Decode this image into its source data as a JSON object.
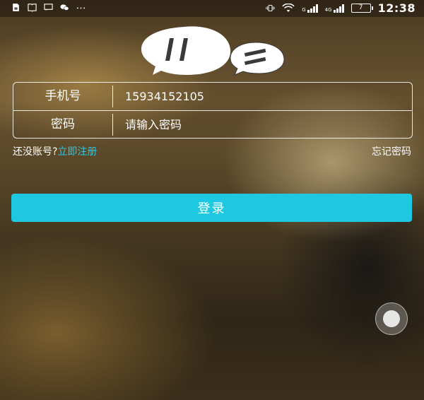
{
  "status_bar": {
    "time": "12:38",
    "battery_level": "7",
    "network_label_1": "G",
    "network_label_2": "4G",
    "icons": [
      "sim-icon",
      "book-icon",
      "message-icon",
      "wechat-icon",
      "more-dots-icon",
      "vibrate-icon",
      "wifi-icon",
      "signal-icon",
      "battery-icon"
    ]
  },
  "logo": {
    "icon": "chat-bubbles-logo",
    "colors": [
      "#ffffff",
      "#3a3a3a"
    ]
  },
  "form": {
    "phone_label": "手机号",
    "phone_value": "15934152105",
    "password_label": "密码",
    "password_placeholder": "请输入密码"
  },
  "links": {
    "register_prompt": "还没账号?",
    "register_link": "立即注册",
    "forgot_password": "忘记密码"
  },
  "login_button": {
    "label": "登录"
  },
  "colors": {
    "accent": "#1ec8e0",
    "link": "#2ec7e2",
    "text": "#ffffff"
  }
}
